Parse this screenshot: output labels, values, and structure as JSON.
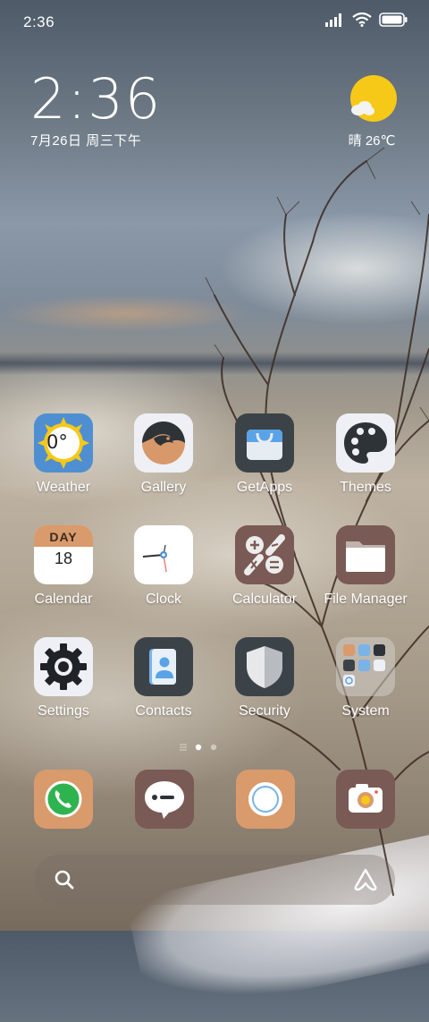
{
  "status_bar": {
    "time": "2:36",
    "icons": [
      "signal-icon",
      "wifi-icon",
      "battery-icon"
    ]
  },
  "clock_widget": {
    "time": "2:36",
    "date": "7月26日 周三下午"
  },
  "weather_widget": {
    "condition": "晴",
    "temperature": "26℃",
    "icon": "sun-cloud-icon"
  },
  "apps": [
    {
      "label": "Weather",
      "icon": "weather-icon",
      "temp": "0°"
    },
    {
      "label": "Gallery",
      "icon": "gallery-icon"
    },
    {
      "label": "GetApps",
      "icon": "getapps-icon"
    },
    {
      "label": "Themes",
      "icon": "themes-icon"
    },
    {
      "label": "Calendar",
      "icon": "calendar-icon",
      "day_label": "DAY",
      "day_number": "18"
    },
    {
      "label": "Clock",
      "icon": "clock-icon"
    },
    {
      "label": "Calculator",
      "icon": "calculator-icon"
    },
    {
      "label": "File Manager",
      "icon": "file-manager-icon"
    },
    {
      "label": "Settings",
      "icon": "settings-icon"
    },
    {
      "label": "Contacts",
      "icon": "contacts-icon"
    },
    {
      "label": "Security",
      "icon": "security-icon"
    },
    {
      "label": "System",
      "icon": "system-folder-icon"
    }
  ],
  "page_indicator": {
    "pages": 2,
    "current": 1
  },
  "dock": [
    {
      "icon": "phone-icon"
    },
    {
      "icon": "messages-icon"
    },
    {
      "icon": "browser-icon"
    },
    {
      "icon": "camera-icon"
    }
  ],
  "search_bar": {
    "left_icon": "search-icon",
    "right_icon": "assistant-icon"
  },
  "colors": {
    "accent_peach": "#d99a6c",
    "accent_mauve": "#7a5a54",
    "dark_slate": "#3c4348",
    "sun_yellow": "#f6c918"
  }
}
